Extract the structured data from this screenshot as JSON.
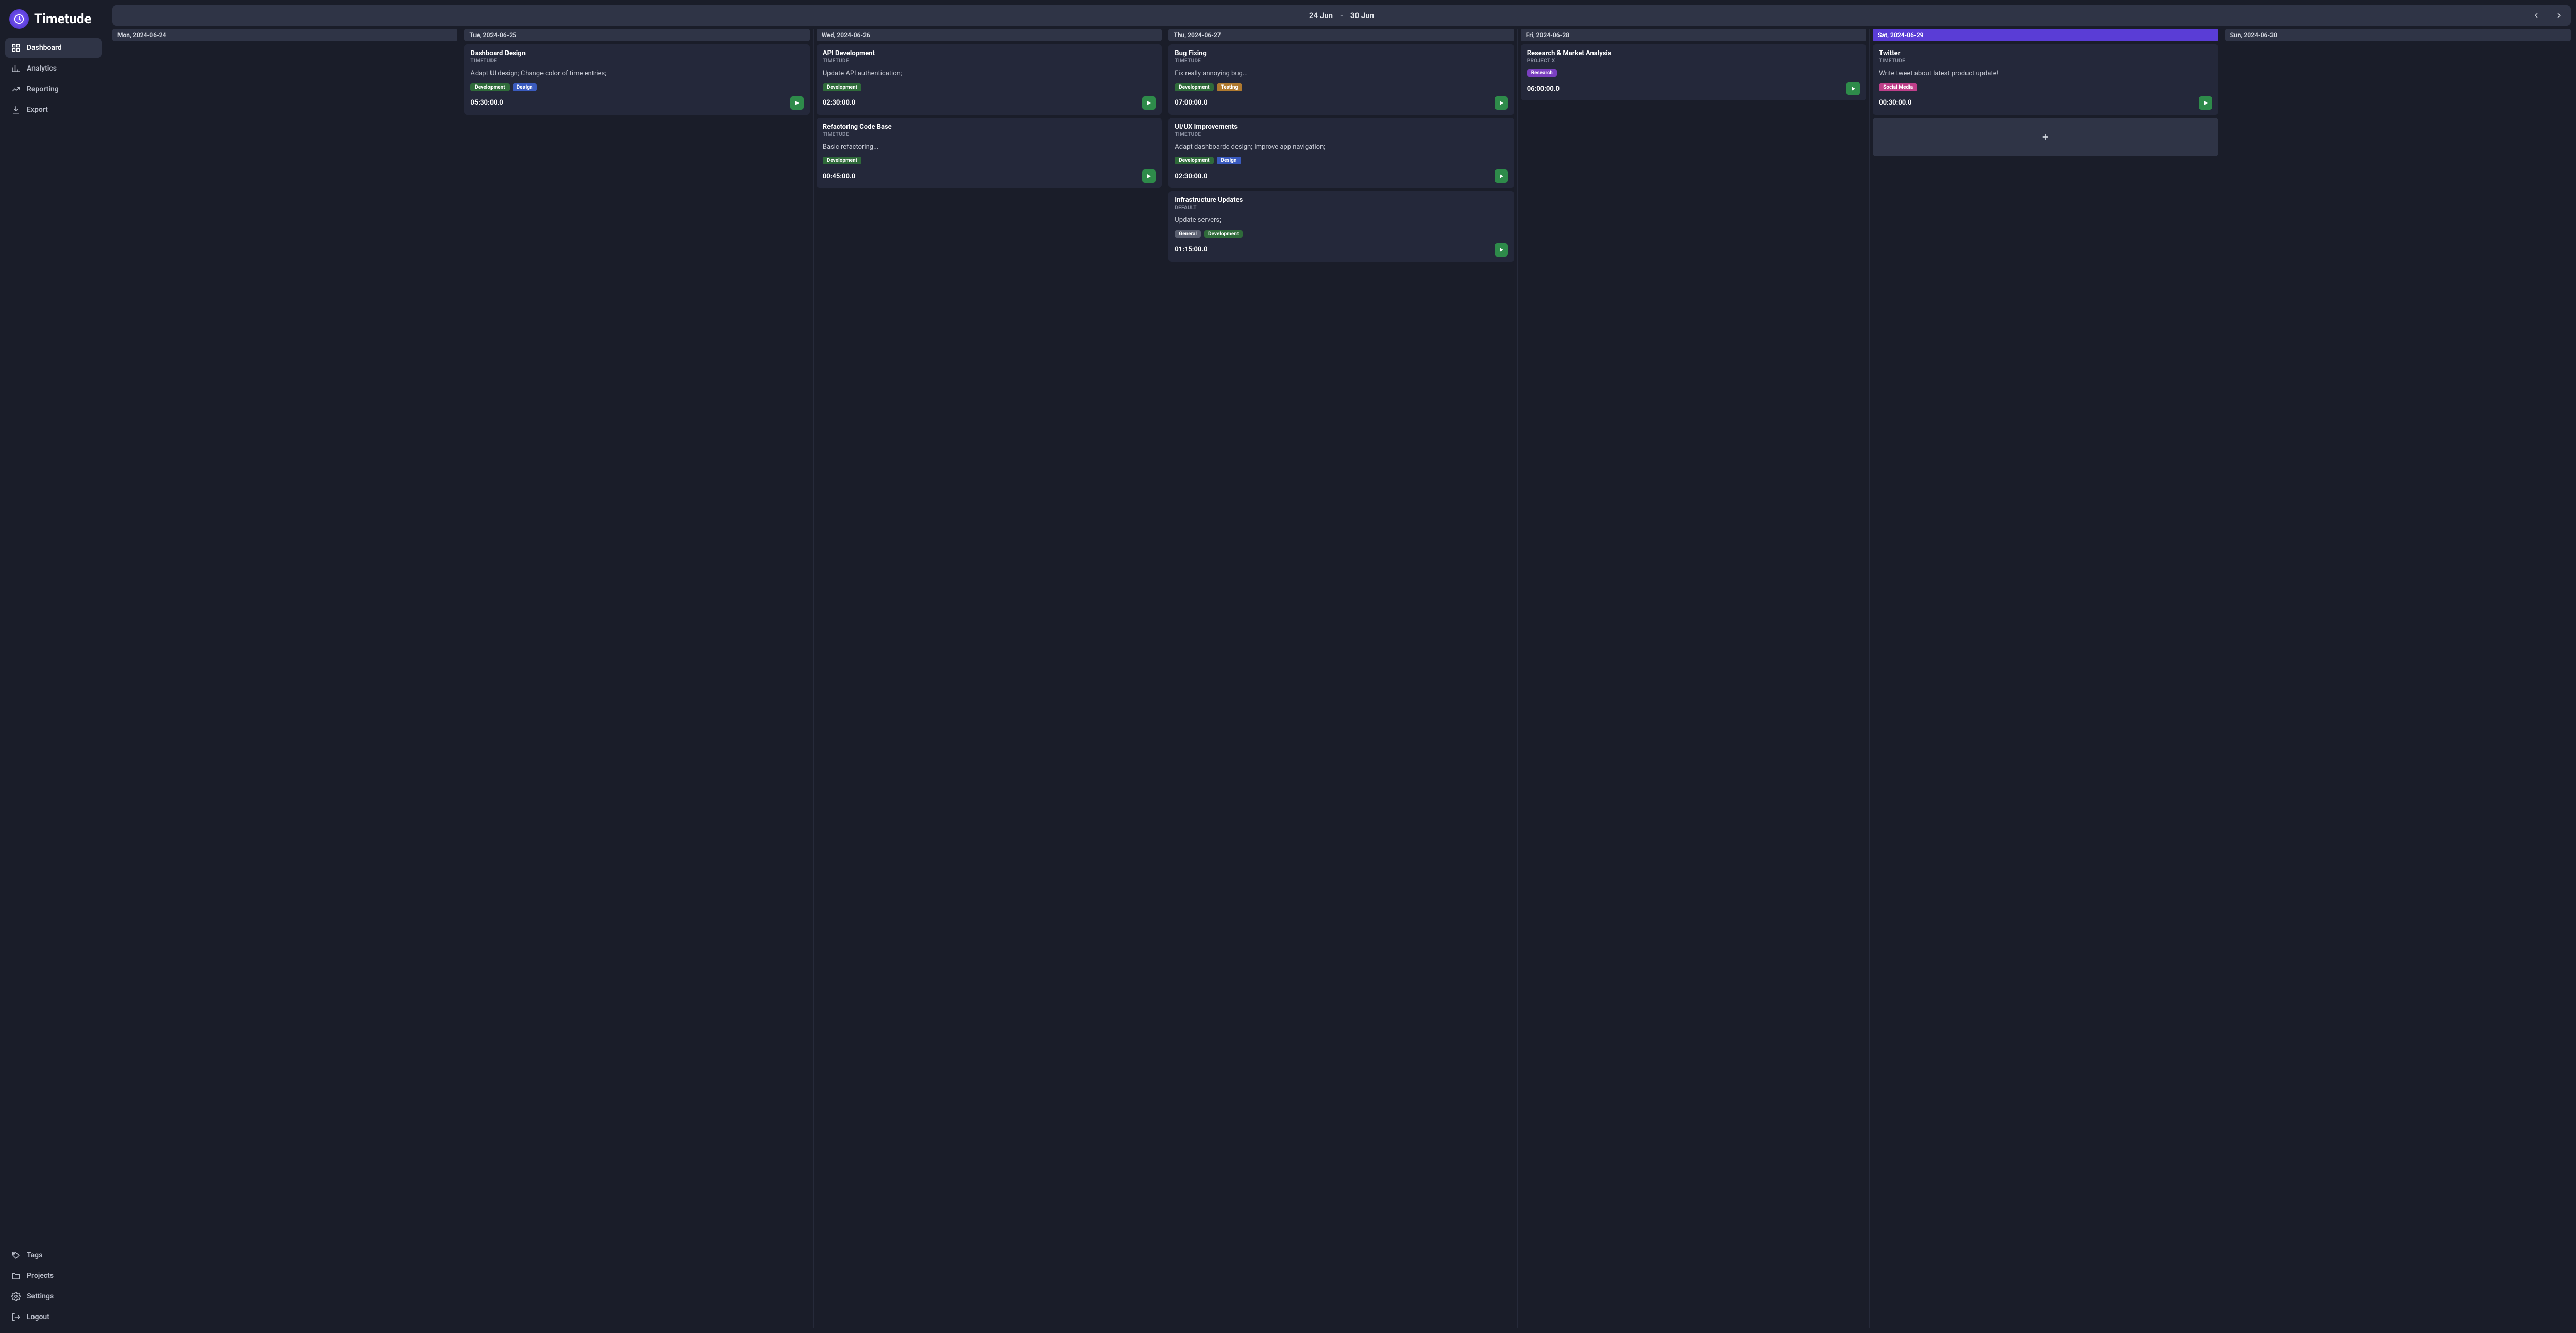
{
  "brand": {
    "name": "Timetude"
  },
  "nav": {
    "primary": [
      {
        "id": "dashboard",
        "label": "Dashboard",
        "active": true
      },
      {
        "id": "analytics",
        "label": "Analytics",
        "active": false
      },
      {
        "id": "reporting",
        "label": "Reporting",
        "active": false
      },
      {
        "id": "export",
        "label": "Export",
        "active": false
      }
    ],
    "secondary": [
      {
        "id": "tags",
        "label": "Tags"
      },
      {
        "id": "projects",
        "label": "Projects"
      },
      {
        "id": "settings",
        "label": "Settings"
      },
      {
        "id": "logout",
        "label": "Logout"
      }
    ]
  },
  "header": {
    "range_start": "24 Jun",
    "range_sep": "-",
    "range_end": "30 Jun"
  },
  "colors": {
    "accent": "#5a3dd6",
    "play": "#2e8b4a",
    "tags": {
      "development": "#2f6b3a",
      "design": "#3a5bbf",
      "testing": "#b07a2f",
      "research": "#7a3fbf",
      "social-media": "#bf3f8a",
      "general": "#5a5f70"
    }
  },
  "days": [
    {
      "label": "Mon, 2024-06-24",
      "highlight": false,
      "cards": []
    },
    {
      "label": "Tue, 2024-06-25",
      "highlight": false,
      "cards": [
        {
          "title": "Dashboard Design",
          "project": "TIMETUDE",
          "desc": "Adapt UI design; Change color of time entries;",
          "tags": [
            "Development",
            "Design"
          ],
          "duration": "05:30:00.0"
        }
      ]
    },
    {
      "label": "Wed, 2024-06-26",
      "highlight": false,
      "cards": [
        {
          "title": "API Development",
          "project": "TIMETUDE",
          "desc": "Update API authentication;",
          "tags": [
            "Development"
          ],
          "duration": "02:30:00.0"
        },
        {
          "title": "Refactoring Code Base",
          "project": "TIMETUDE",
          "desc": "Basic refactoring...",
          "tags": [
            "Development"
          ],
          "duration": "00:45:00.0"
        }
      ]
    },
    {
      "label": "Thu, 2024-06-27",
      "highlight": false,
      "cards": [
        {
          "title": "Bug Fixing",
          "project": "TIMETUDE",
          "desc": "Fix really annoying bug...",
          "tags": [
            "Development",
            "Testing"
          ],
          "duration": "07:00:00.0"
        },
        {
          "title": "UI/UX Improvements",
          "project": "TIMETUDE",
          "desc": "Adapt dashboardc design; Improve app navigation;",
          "tags": [
            "Development",
            "Design"
          ],
          "duration": "02:30:00.0"
        },
        {
          "title": "Infrastructure Updates",
          "project": "DEFAULT",
          "desc": "Update servers;",
          "tags": [
            "General",
            "Development"
          ],
          "duration": "01:15:00.0"
        }
      ]
    },
    {
      "label": "Fri, 2024-06-28",
      "highlight": false,
      "cards": [
        {
          "title": "Research & Market Analysis",
          "project": "PROJECT X",
          "desc": "",
          "tags": [
            "Research"
          ],
          "duration": "06:00:00.0"
        }
      ]
    },
    {
      "label": "Sat, 2024-06-29",
      "highlight": true,
      "cards": [
        {
          "title": "Twitter",
          "project": "TIMETUDE",
          "desc": "Write tweet about latest product update!",
          "tags": [
            "Social Media"
          ],
          "duration": "00:30:00.0"
        }
      ],
      "show_add": true
    },
    {
      "label": "Sun, 2024-06-30",
      "highlight": false,
      "cards": []
    }
  ]
}
